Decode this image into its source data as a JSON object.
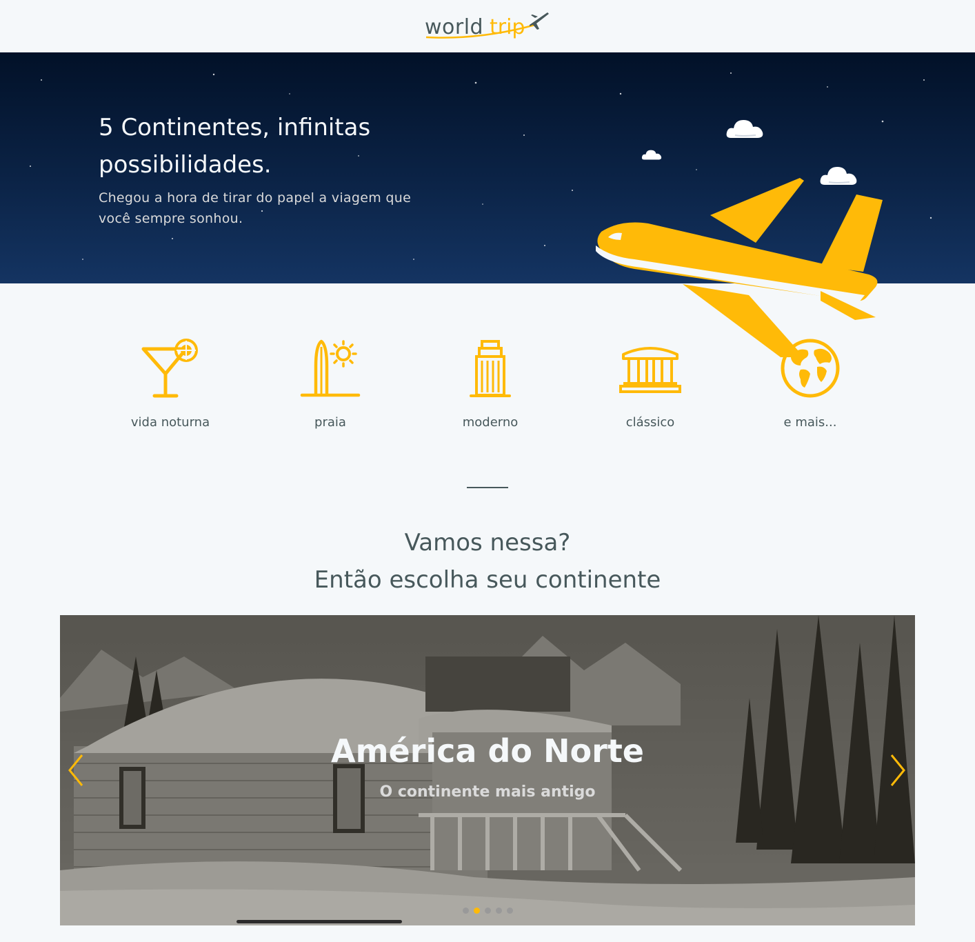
{
  "header": {
    "logo_world": "world",
    "logo_trip": "trip"
  },
  "banner": {
    "title_line1": "5 Continentes, infinitas",
    "title_line2": "possibilidades.",
    "subtitle_line1": "Chegou a hora de tirar do papel a viagem que",
    "subtitle_line2": "você sempre sonhou."
  },
  "travel_types": [
    {
      "label": "vida noturna",
      "icon": "cocktail-icon"
    },
    {
      "label": "praia",
      "icon": "surfboard-sun-icon"
    },
    {
      "label": "moderno",
      "icon": "skyscraper-icon"
    },
    {
      "label": "clássico",
      "icon": "colosseum-icon"
    },
    {
      "label": "e mais...",
      "icon": "globe-icon"
    }
  ],
  "call_to_action": {
    "line1": "Vamos nessa?",
    "line2": "Então escolha seu continente"
  },
  "slider": {
    "title": "América do Norte",
    "subtitle": "O continente mais antigo",
    "slide_count": 5,
    "active_slide": 2
  },
  "colors": {
    "highlight": "#ffba08",
    "dark_text": "#47585b",
    "light_bg": "#f5f8fa",
    "night_sky": "#0b2346"
  }
}
